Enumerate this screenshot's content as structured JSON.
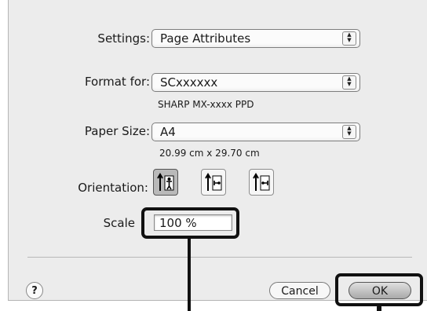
{
  "settings": {
    "label": "Settings:",
    "value": "Page Attributes"
  },
  "format_for": {
    "label": "Format for:",
    "value": "SCxxxxxx",
    "subtitle": "SHARP MX-xxxx PPD"
  },
  "paper_size": {
    "label": "Paper Size:",
    "value": "A4",
    "dimensions": "20.99 cm x 29.70 cm"
  },
  "orientation": {
    "label": "Orientation:",
    "options": [
      {
        "name": "portrait",
        "selected": true
      },
      {
        "name": "landscape-left",
        "selected": false
      },
      {
        "name": "landscape-right",
        "selected": false
      }
    ]
  },
  "scale": {
    "label": "Scale",
    "value": "100 %"
  },
  "buttons": {
    "help": "?",
    "cancel": "Cancel",
    "ok": "OK"
  },
  "colors": {
    "dialog_bg": "#ececec",
    "callout": "#111111"
  }
}
